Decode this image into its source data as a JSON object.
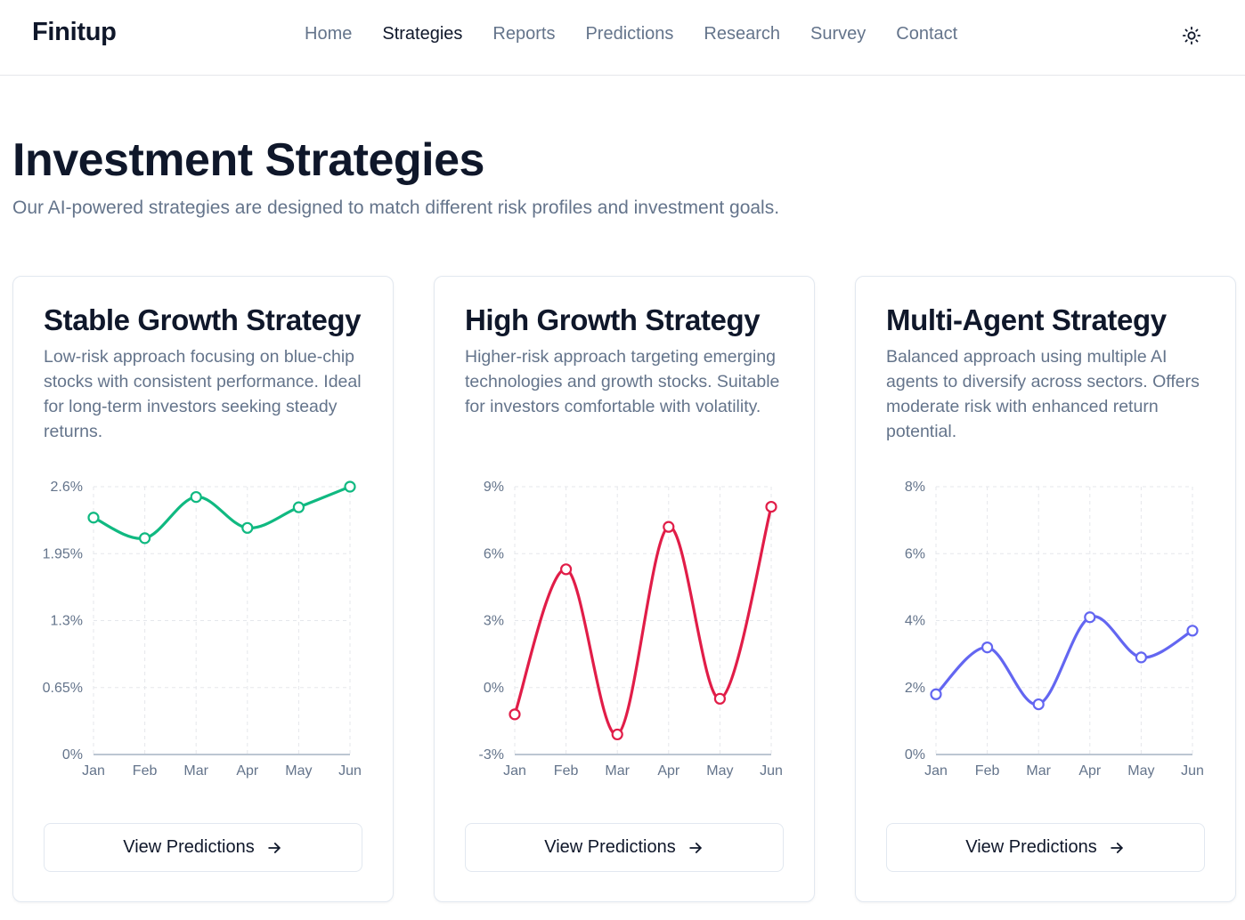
{
  "header": {
    "logo": "Finitup",
    "nav": [
      {
        "label": "Home",
        "active": false
      },
      {
        "label": "Strategies",
        "active": true
      },
      {
        "label": "Reports",
        "active": false
      },
      {
        "label": "Predictions",
        "active": false
      },
      {
        "label": "Research",
        "active": false
      },
      {
        "label": "Survey",
        "active": false
      },
      {
        "label": "Contact",
        "active": false
      }
    ],
    "theme_icon": "sun-icon"
  },
  "main": {
    "title": "Investment Strategies",
    "subtitle": "Our AI-powered strategies are designed to match different risk profiles and investment goals."
  },
  "cards": [
    {
      "title": "Stable Growth Strategy",
      "description": "Low-risk approach focusing on blue-chip stocks with consistent performance. Ideal for long-term investors seeking steady returns.",
      "button_label": "View Predictions",
      "button_icon": "arrow-right-icon"
    },
    {
      "title": "High Growth Strategy",
      "description": "Higher-risk approach targeting emerging technologies and growth stocks. Suitable for investors comfortable with volatility.",
      "button_label": "View Predictions",
      "button_icon": "arrow-right-icon"
    },
    {
      "title": "Multi-Agent Strategy",
      "description": "Balanced approach using multiple AI agents to diversify across sectors. Offers moderate risk with enhanced return potential.",
      "button_label": "View Predictions",
      "button_icon": "arrow-right-icon"
    }
  ],
  "chart_data": [
    {
      "type": "line",
      "categories": [
        "Jan",
        "Feb",
        "Mar",
        "Apr",
        "May",
        "Jun"
      ],
      "series": [
        {
          "values": [
            2.3,
            2.1,
            2.5,
            2.2,
            2.4,
            2.6
          ]
        }
      ],
      "yticks": [
        "0%",
        "0.65%",
        "1.3%",
        "1.95%",
        "2.6%"
      ],
      "ylim": [
        0,
        2.6
      ],
      "color": "#10b981",
      "grid": true
    },
    {
      "type": "line",
      "categories": [
        "Jan",
        "Feb",
        "Mar",
        "Apr",
        "May",
        "Jun"
      ],
      "series": [
        {
          "values": [
            -1.2,
            5.3,
            -2.1,
            7.2,
            -0.5,
            8.1
          ]
        }
      ],
      "yticks": [
        "-3%",
        "0%",
        "3%",
        "6%",
        "9%"
      ],
      "ylim": [
        -3,
        9
      ],
      "color": "#e11d48",
      "grid": true
    },
    {
      "type": "line",
      "categories": [
        "Jan",
        "Feb",
        "Mar",
        "Apr",
        "May",
        "Jun"
      ],
      "series": [
        {
          "values": [
            1.8,
            3.2,
            1.5,
            4.1,
            2.9,
            3.7
          ]
        }
      ],
      "yticks": [
        "0%",
        "2%",
        "4%",
        "6%",
        "8%"
      ],
      "ylim": [
        0,
        8
      ],
      "color": "#6366f1",
      "grid": true
    }
  ]
}
